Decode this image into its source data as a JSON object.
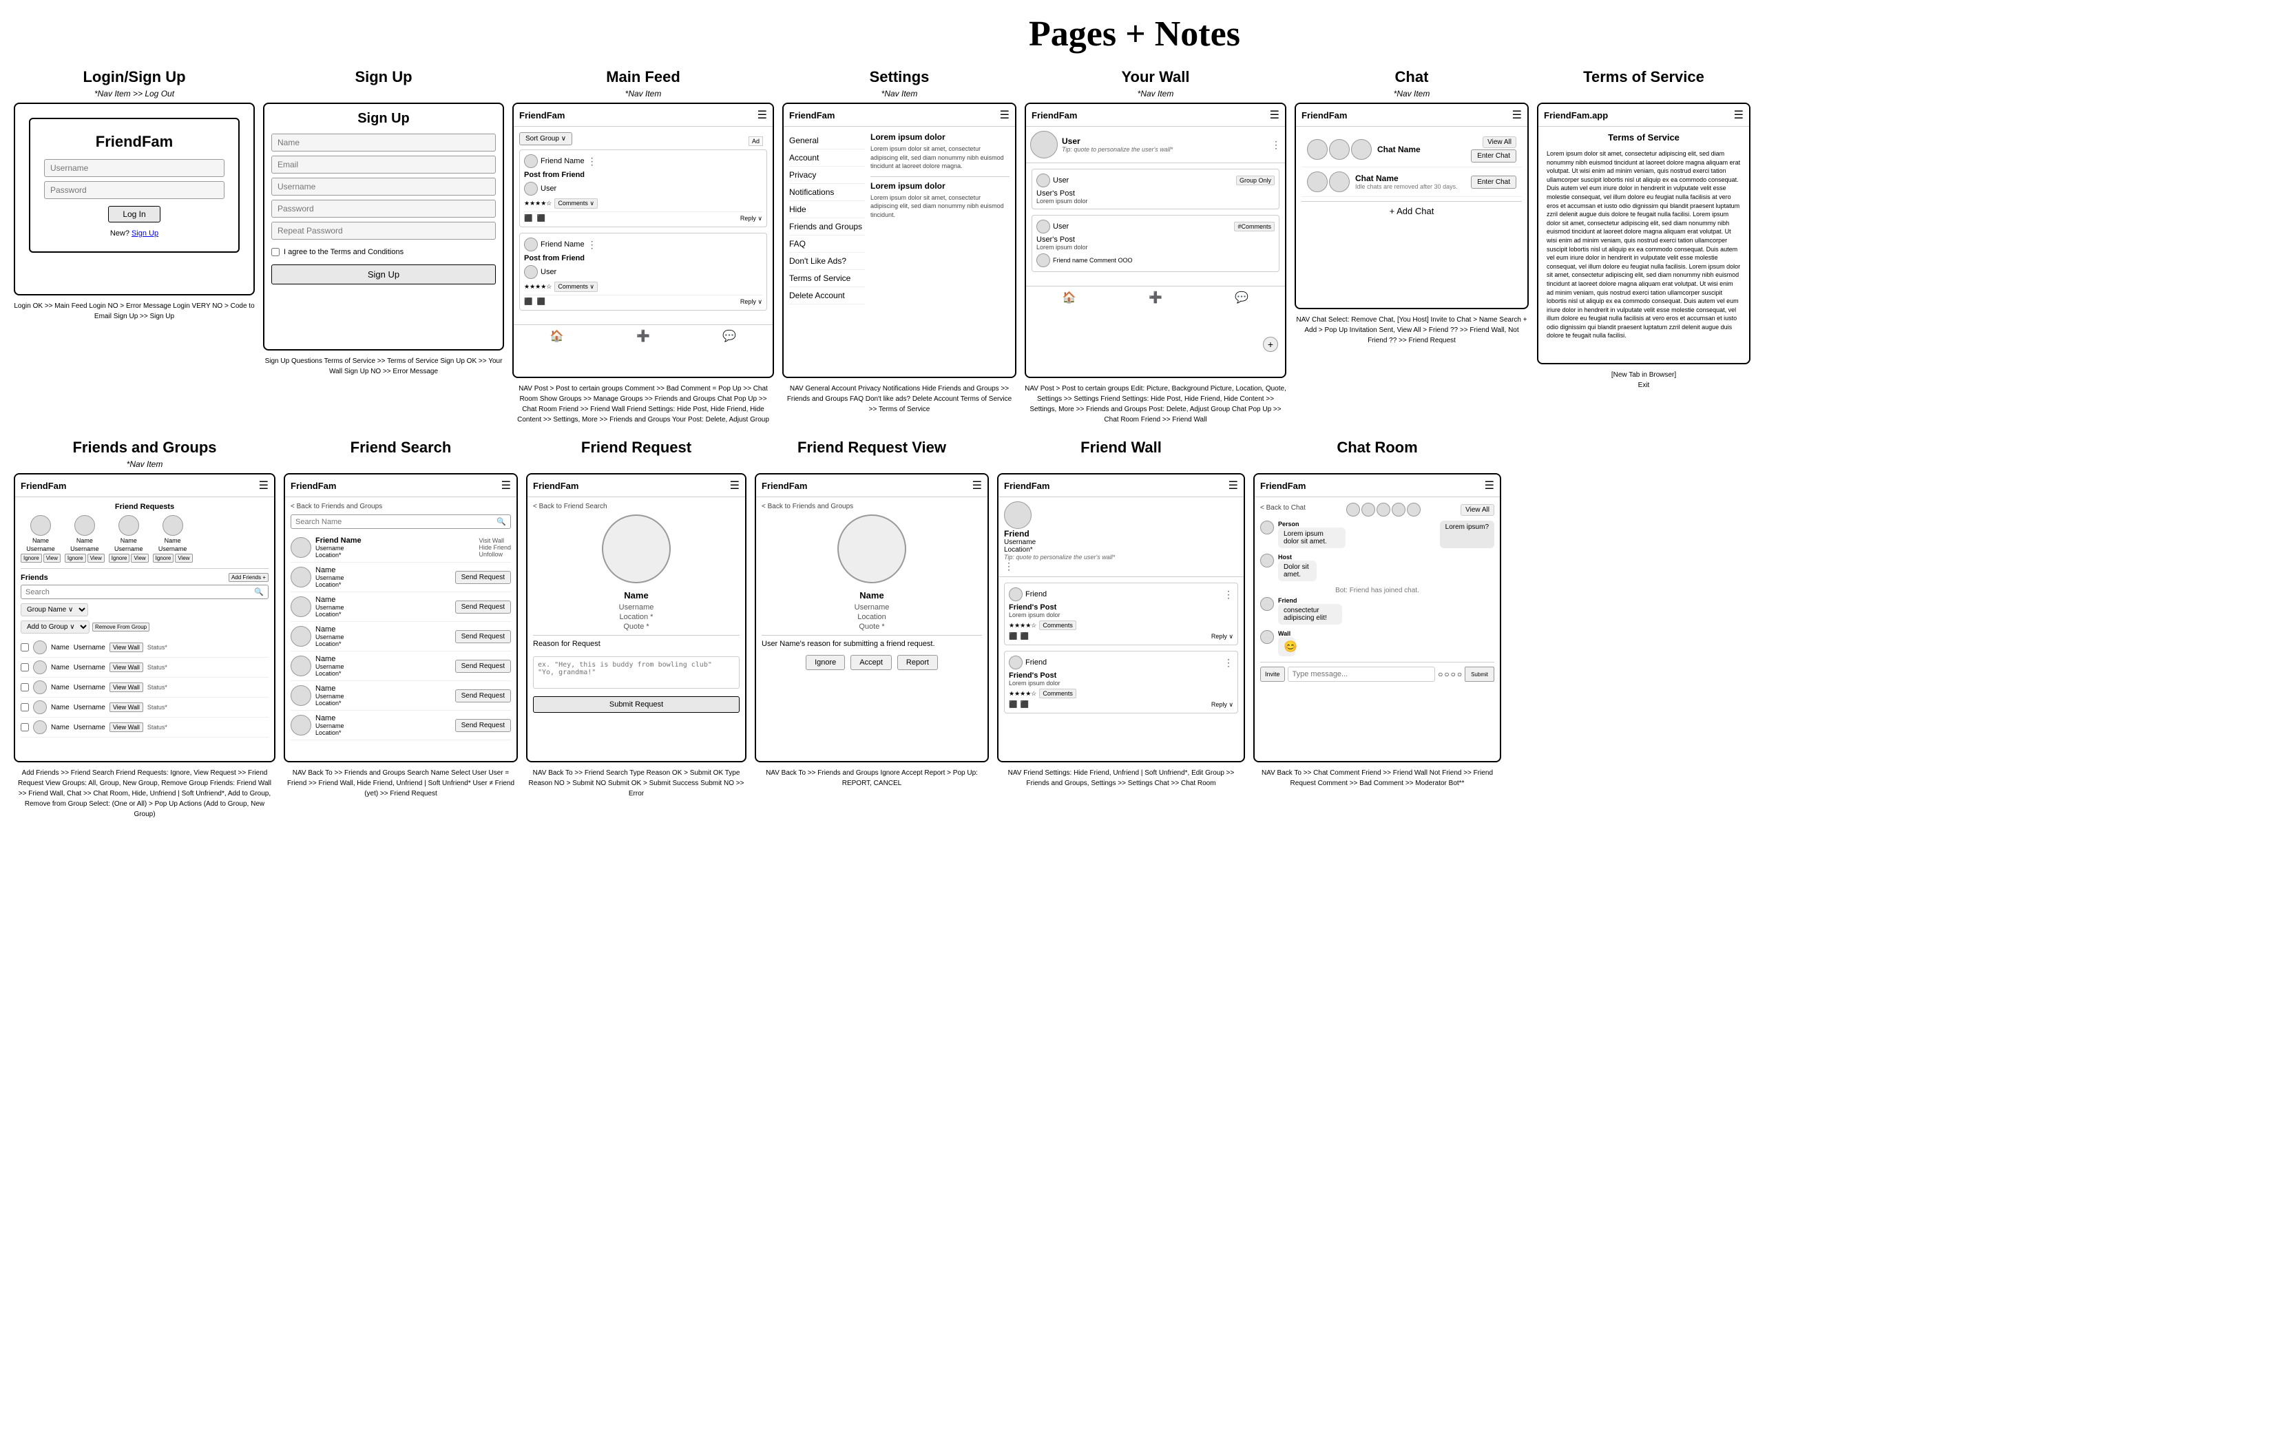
{
  "page": {
    "title": "Pages + Notes"
  },
  "sections_row1": [
    {
      "id": "login-signup",
      "title": "Login/Sign Up",
      "subtitle": "*Nav Item >> Log Out",
      "app_name": "FriendFam",
      "fields": [
        "Username",
        "Password"
      ],
      "btn": "Log In",
      "new_text": "New?",
      "signup_link": "Sign Up",
      "notes": "Login OK >> Main Feed\nLogin NO > Error Message\nLogin VERY NO > Code to Email\nSign Up >> Sign Up"
    },
    {
      "id": "sign-up",
      "title": "Sign Up",
      "subtitle": "",
      "inner_title": "Sign Up",
      "fields": [
        "Name",
        "Email",
        "Username",
        "Password",
        "Repeat Password"
      ],
      "checkbox_text": "I agree to the Terms and Conditions",
      "btn": "Sign Up",
      "notes": "Sign Up Questions\nTerms of Service >> Terms of Service\nSign Up OK >> Your Wall\nSign Up NO >> Error Message"
    },
    {
      "id": "main-feed",
      "title": "Main Feed",
      "subtitle": "*Nav Item",
      "app_name": "FriendFam",
      "sort_label": "Sort Group ∨",
      "ad_label": "Ad",
      "posts": [
        {
          "type": "Post from Friend",
          "user": "User",
          "comments": "Comments ∨"
        },
        {
          "type": "Post from Friend",
          "user": "User",
          "comments": "Comments ∨"
        }
      ],
      "nav_items": [
        "🏠",
        "+",
        "💬"
      ],
      "notes": "NAV\nPost > Post to certain groups\nComment >> Bad Comment = Pop Up >> Chat Room\nShow Groups >> Manage Groups >> Friends and Groups\nChat Pop Up >> Chat Room\nFriend >> Friend Wall\nFriend Settings: Hide Post, Hide Friend, Hide Content\n>> Settings, More >> Friends and Groups\nYour Post: Delete, Adjust Group"
    },
    {
      "id": "settings",
      "title": "Settings",
      "subtitle": "*Nav Item",
      "app_name": "FriendFam",
      "lorem_title": "Lorem ipsum dolor",
      "lorem_text": "Lorem ipsum dolor sit amet, consectetur adipiscing elit, sed diam nonummy nibh euismod tincidunt at laoreet dolore magna.",
      "items": [
        "General",
        "Account",
        "Privacy",
        "Notifications",
        "Hide",
        "Friends and Groups",
        "FAQ",
        "Don't Like Ads?",
        "Terms of Service",
        "Delete Account"
      ],
      "lorem_title2": "Lorem ipsum dolor",
      "lorem_text2": "Lorem ipsum dolor sit amet, consectetur adipiscing elit, sed diam nonummy nibh euismod tincidunt.",
      "notes": "NAV\nGeneral\nAccount\nPrivacy\nNotifications\nHide\nFriends and Groups >> Friends and Groups\nFAQ\nDon't like ads?\nDelete Account\nTerms of Service >> Terms of Service"
    },
    {
      "id": "your-wall",
      "title": "Your Wall",
      "subtitle": "*Nav Item",
      "app_name": "FriendFam",
      "user_label": "User",
      "quote_tip": "Tip: quote to personalize the user's wall*",
      "posts": [
        {
          "label": "User",
          "tag": "Group Only"
        },
        {
          "label": "User",
          "tag": "#Comments"
        }
      ],
      "post_label": "User's Post",
      "fab": "+",
      "notes": "NAV\nPost > Post to certain groups\nEdit: Picture, Background Picture, Location, Quote, Settings >> Settings\nFriend Settings: Hide Post, Hide Friend, Hide Content\n>> Settings, More >> Friends and Groups\nPost: Delete, Adjust Group\nChat Pop Up >> Chat Room\nFriend >> Friend Wall"
    },
    {
      "id": "chat",
      "title": "Chat",
      "subtitle": "*Nav Item",
      "app_name": "FriendFam",
      "chat_name1": "Chat Name",
      "chat_name2": "Chat Name",
      "view_all": "View All",
      "idle_msg": "Idle chats are removed after 30 days.",
      "enter_chat": "Enter Chat",
      "add_chat": "+ Add Chat",
      "notes": "NAV\nChat Select: Remove Chat, [You Host] Invite to Chat > Name Search + Add > Pop Up Invitation Sent, View All > Friend ?? >> Friend Wall, Not Friend ?? >> Friend Request"
    },
    {
      "id": "tos",
      "title": "Terms of Service",
      "subtitle": "",
      "app_name": "FriendFam.app",
      "tos_title": "Terms of Service",
      "tos_body": "Lorem ipsum dolor sit amet, consectetur adipiscing elit, sed diam nonummy nibh euismod tincidunt at laoreet dolore magna aliquam erat volutpat. Ut wisi enim ad minim veniam, quis nostrud exerci tation ullamcorper suscipit lobortis nisl ut aliquip ex ea commodo consequat. Duis autem vel eum iriure dolor in hendrerit in vulputate velit esse molestie consequat, vel illum dolore eu feugiat nulla facilisis at vero eros et accumsan et iusto odio dignissim qui blandit praesent luptatum zzril delenit augue duis dolore te feugait nulla facilisi.\n\nLorem ipsum dolor sit amet, consectetur adipiscing elit, sed diam nonummy nibh euismod tincidunt at laoreet dolore magna aliquam erat volutpat. Ut wisi enim ad minim veniam, quis nostrud exerci tation ullamcorper suscipit lobortis nisl ut aliquip ex ea commodo consequat. Duis autem vel eum iriure dolor in hendrerit in vulputate velit esse molestie consequat, vel illum dolore eu feugiat nulla facilisis.\n\nLorem ipsum dolor sit amet, consectetur adipiscing elit, sed diam nonummy nibh euismod tincidunt at laoreet dolore magna aliquam erat volutpat. Ut wisi enim ad minim veniam, quis nostrud exerci tation ullamcorper suscipit lobortis nisl ut aliquip ex ea commodo consequat. Duis autem vel eum iriure dolor in hendrerit in vulputate velit esse molestie consequat, vel illum dolore eu feugiat nulla facilisis at vero eros et accumsan et iusto odio dignissim qui blandit praesent luptatum zzril delenit augue duis dolore te feugait nulla facilisi.",
      "new_tab_note": "[New Tab in Browser]",
      "exit_note": "Exit"
    }
  ],
  "sections_row2": [
    {
      "id": "friends-groups",
      "title": "Friends and Groups",
      "subtitle": "*Nav Item",
      "app_name": "FriendFam",
      "friend_requests_label": "Friend Requests",
      "friend_req_items": [
        {
          "name": "Name",
          "username": "Username",
          "actions": [
            "Ignore",
            "View"
          ]
        },
        {
          "name": "Name",
          "username": "Username",
          "actions": [
            "Ignore",
            "View"
          ]
        },
        {
          "name": "Name",
          "username": "Username",
          "actions": [
            "Ignore",
            "View"
          ]
        },
        {
          "name": "Name",
          "username": "Username",
          "actions": [
            "Ignore",
            "View"
          ]
        }
      ],
      "friends_label": "Friends",
      "add_friends": "Add Friends +",
      "search_placeholder": "Search",
      "group_name_select": "Group Name ∨",
      "manage_options": [
        "Add to Group ∨",
        "Remove From Group"
      ],
      "friend_list": [
        {
          "name": "Name",
          "username": "Username",
          "status": "Status*"
        },
        {
          "name": "Name",
          "username": "Username",
          "status": "Status*"
        },
        {
          "name": "Name",
          "username": "Username",
          "status": "Status*"
        },
        {
          "name": "Name",
          "username": "Username",
          "status": "Status*"
        },
        {
          "name": "Name",
          "username": "Username",
          "status": "Status*"
        }
      ],
      "notes": "Add Friends >> Friend Search\nFriend Requests: Ignore, View Request >> Friend Request View\nGroups: All, Group, New Group, Remove Group\nFriends: Friend Wall >> Friend Wall, Chat >> Chat Room, Hide, Unfriend | Soft Unfriend*, Add to Group, Remove from Group\nSelect: (One or All) > Pop Up Actions (Add to Group, New Group)"
    },
    {
      "id": "friend-search",
      "title": "Friend Search",
      "subtitle": "",
      "app_name": "FriendFam",
      "back_label": "Back to Friends and Groups",
      "search_placeholder": "Search Name",
      "results": [
        {
          "name": "Friend Name",
          "username": "Username",
          "location": "Location*",
          "visit_options": [
            "Visit Wall",
            "Hide Friend",
            "Unfollow"
          ]
        },
        {
          "name": "Name",
          "username": "Username",
          "location": "Location*"
        },
        {
          "name": "Name",
          "username": "Username",
          "location": "Location*"
        },
        {
          "name": "Name",
          "username": "Username",
          "location": "Location*"
        },
        {
          "name": "Name",
          "username": "Username",
          "location": "Location*"
        },
        {
          "name": "Name",
          "username": "Username",
          "location": "Location*"
        },
        {
          "name": "Name",
          "username": "Username",
          "location": "Location*"
        }
      ],
      "send_req_label": "Send Request",
      "notes": "NAV\nBack To >> Friends and Groups\nSearch Name\nSelect User\nUser = Friend >> Friend Wall, Hide Friend, Unfriend | Soft Unfriend*\nUser ≠ Friend (yet) >> Friend Request"
    },
    {
      "id": "friend-request",
      "title": "Friend Request",
      "subtitle": "",
      "app_name": "FriendFam",
      "back_label": "Back to Friend Search",
      "profile_name": "Name",
      "profile_username": "Username",
      "profile_location": "Location *",
      "profile_quote": "Quote *",
      "reason_label": "Reason for Request",
      "reason_placeholder": "ex. \"Hey, this is buddy from bowling club\"\n\"Yo, grandma!\"",
      "submit_btn": "Submit Request",
      "notes": "NAV\nBack To >> Friend Search\nType Reason OK > Submit OK\nType Reason NO > Submit NO\nSubmit OK > Submit Success\nSubmit NO >> Error"
    },
    {
      "id": "friend-request-view",
      "title": "Friend Request View",
      "subtitle": "",
      "app_name": "FriendFam",
      "back_label": "Back to Friends and Groups",
      "profile_name": "Name",
      "profile_username": "Username",
      "profile_location": "Location",
      "profile_quote": "Quote *",
      "reason_label": "User Name's reason for submitting a friend request.",
      "actions": [
        "Ignore",
        "Accept",
        "Report"
      ],
      "notes": "NAV\nBack To >> Friends and Groups\nIgnore\nAccept\nReport > Pop Up: REPORT, CANCEL"
    },
    {
      "id": "friend-wall",
      "title": "Friend Wall",
      "subtitle": "",
      "app_name": "FriendFam",
      "friend_label": "Friend",
      "friend_username": "Username",
      "friend_location": "Location*",
      "quote_tip": "Tip: quote to personalize the user's wall*",
      "posts": [
        {
          "label": "Friend",
          "type": "Friend's Post"
        },
        {
          "label": "Friend",
          "type": "Friend's Post"
        }
      ],
      "notes": "NAV\nFriend Settings: Hide Friend, Unfriend | Soft Unfriend*, Edit Group >> Friends and Groups, Settings\n>> Settings\nChat >> Chat Room"
    },
    {
      "id": "chat-room",
      "title": "Chat Room",
      "subtitle": "",
      "app_name": "FriendFam",
      "back_label": "Back to Chat",
      "view_all": "View All",
      "messages": [
        {
          "sender": "Person",
          "text": "Lorem ipsum dolor sit amet.",
          "type": "received"
        },
        {
          "sender": "Host",
          "text": "Dolor sit amet.",
          "type": "received"
        },
        {
          "sender": "Bot",
          "text": "Friend has joined chat.",
          "type": "system"
        },
        {
          "sender": "Friend",
          "text": "consectetur adipiscing elit!",
          "type": "received"
        },
        {
          "sender": "Wall",
          "text": "",
          "type": "wall",
          "icon": "😊"
        }
      ],
      "type_placeholder": "Type message...",
      "invite_btn": "Invite",
      "submit_btn": "Submit",
      "notes": "NAV\nBack To >> Chat\nComment\nFriend >> Friend Wall\nNot Friend >> Friend Request\nComment >> Bad Comment >> Moderator Bot**"
    }
  ]
}
